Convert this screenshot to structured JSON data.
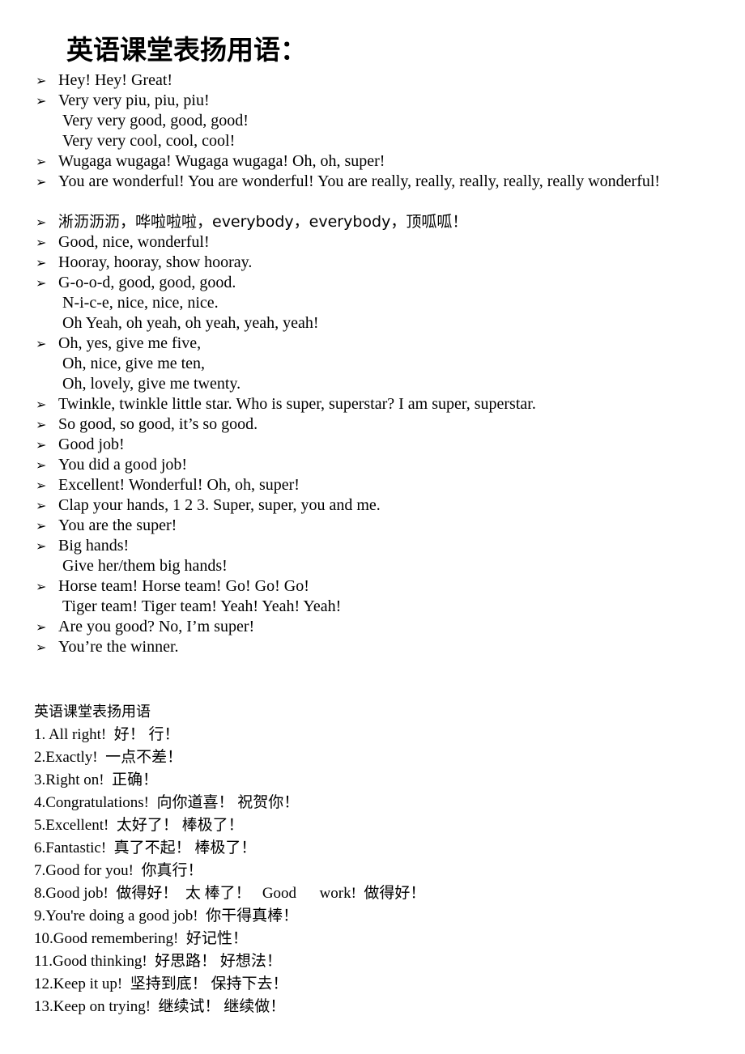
{
  "document": {
    "title": "英语课堂表扬用语：",
    "bullet_marker_glyph": "➢",
    "bullet_items": [
      {
        "lines": [
          "Hey! Hey! Great!"
        ]
      },
      {
        "lines": [
          "Very very piu, piu, piu!",
          "Very very good, good, good!",
          "Very very cool, cool, cool!"
        ]
      },
      {
        "lines": [
          "Wugaga wugaga! Wugaga wugaga! Oh, oh, super!"
        ]
      },
      {
        "justified": true,
        "lines": [
          "You are wonderful! You are wonderful! You are really, really, really, really, really wonderful!"
        ]
      },
      {
        "chinese": true,
        "lines": [
          "淅沥沥沥，哗啦啦啦，everybody，everybody，顶呱呱！"
        ]
      },
      {
        "lines": [
          "Good, nice, wonderful!"
        ]
      },
      {
        "lines": [
          "Hooray, hooray, show hooray."
        ]
      },
      {
        "lines": [
          "G-o-o-d, good, good, good.",
          "N-i-c-e, nice, nice, nice.",
          "Oh Yeah, oh yeah, oh yeah, yeah, yeah!"
        ]
      },
      {
        "lines": [
          "Oh, yes, give me five,",
          "Oh, nice, give me ten,",
          "Oh, lovely, give me twenty."
        ]
      },
      {
        "lines": [
          "Twinkle, twinkle little star. Who is super, superstar? I am super, superstar."
        ]
      },
      {
        "lines": [
          "So good, so good, it’s so good."
        ]
      },
      {
        "lines": [
          "Good job!"
        ]
      },
      {
        "lines": [
          "You did a good job!"
        ]
      },
      {
        "lines": [
          "Excellent! Wonderful! Oh, oh, super!"
        ]
      },
      {
        "lines": [
          "Clap your hands, 1 2 3. Super, super, you and me."
        ]
      },
      {
        "lines": [
          "You are the super!"
        ]
      },
      {
        "lines": [
          "Big hands!",
          "Give her/them big hands!"
        ]
      },
      {
        "lines": [
          "Horse team! Horse team! Go! Go! Go!",
          "Tiger team! Tiger team! Yeah! Yeah! Yeah!"
        ]
      },
      {
        "lines": [
          "Are you good? No, I’m super!"
        ]
      },
      {
        "lines": [
          "You’re the winner."
        ]
      }
    ],
    "numbered_section": {
      "heading": "英语课堂表扬用语",
      "items": [
        "1. All right!  好！ 行！",
        "2.Exactly!  一点不差！",
        "3.Right on!  正确！",
        "4.Congratulations!  向你道喜！ 祝贺你！",
        "5.Excellent!  太好了！ 棒极了！",
        "6.Fantastic!  真了不起！ 棒极了！",
        "7.Good for you!  你真行！",
        "8.Good job!  做得好！  太 棒了！   Good      work!  做得好！",
        "9.You're doing a good job!  你干得真棒！",
        "10.Good remembering!  好记性！",
        "11.Good thinking!  好思路！ 好想法！",
        "12.Keep it up!  坚持到底！ 保持下去！",
        "13.Keep on trying!  继续试！ 继续做！"
      ]
    }
  }
}
